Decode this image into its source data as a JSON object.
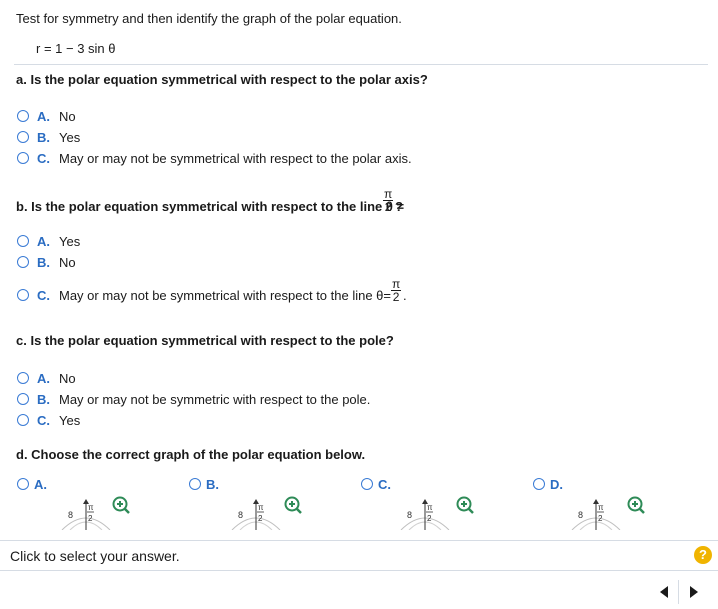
{
  "instruction": "Test for symmetry and then identify the graph of the polar equation.",
  "equation": "r = 1 − 3 sin θ",
  "part_a": {
    "question": "a. Is the polar equation symmetrical with respect to the polar axis?",
    "options": [
      {
        "letter": "A.",
        "text": "No"
      },
      {
        "letter": "B.",
        "text": "Yes"
      },
      {
        "letter": "C.",
        "text": "May or may not be symmetrical with respect to the polar axis."
      }
    ]
  },
  "part_b": {
    "question_prefix": "b. Is the polar equation symmetrical with respect to the line θ =",
    "question_suffix": "?",
    "frac_num": "π",
    "frac_den": "2",
    "options": [
      {
        "letter": "A.",
        "text": "Yes"
      },
      {
        "letter": "B.",
        "text": "No"
      },
      {
        "letter": "C.",
        "text": "May or may not be symmetrical with respect to the line θ=",
        "suffix": "."
      }
    ]
  },
  "part_c": {
    "question": "c. Is the polar equation symmetrical with respect to the pole?",
    "options": [
      {
        "letter": "A.",
        "text": "No"
      },
      {
        "letter": "B.",
        "text": "May or may not be symmetric with respect to the pole."
      },
      {
        "letter": "C.",
        "text": "Yes"
      }
    ]
  },
  "part_d": {
    "question": "d. Choose the correct graph of the polar equation below.",
    "options": [
      {
        "letter": "A."
      },
      {
        "letter": "B."
      },
      {
        "letter": "C."
      },
      {
        "letter": "D."
      }
    ],
    "thumb_label_left": "8",
    "thumb_label_num": "π",
    "thumb_label_den": "2"
  },
  "footer": {
    "prompt": "Click to select your answer.",
    "help": "?"
  },
  "colors": {
    "accent": "#2a6cc2",
    "divider": "#d6dce4",
    "help": "#f0b400"
  },
  "icons": {
    "zoom": "zoom-in-icon",
    "help": "help-icon",
    "prev": "left-arrow-icon",
    "next": "right-arrow-icon"
  }
}
